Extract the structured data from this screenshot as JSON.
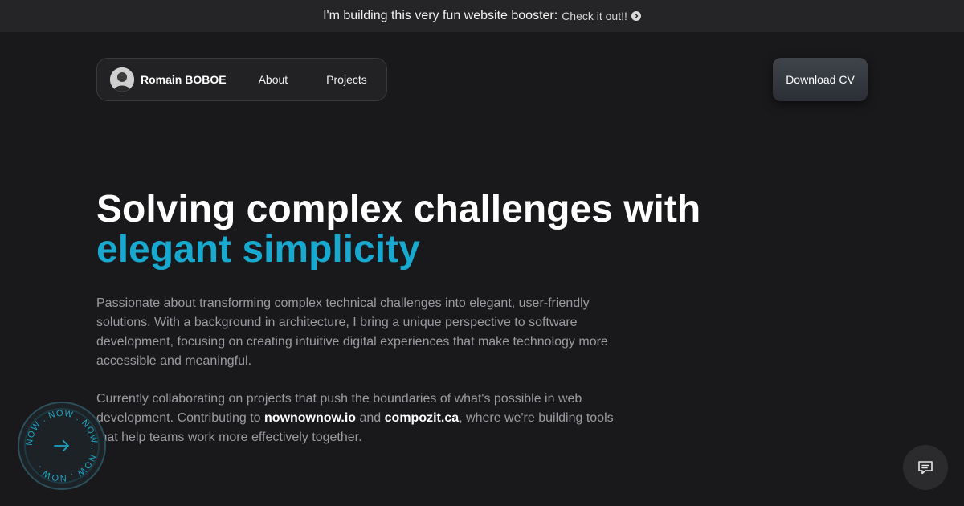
{
  "banner": {
    "text": "I'm building this very fun website booster:",
    "link_label": "Check it out!!",
    "link_icon": "chevron-right-circle-icon"
  },
  "nav": {
    "avatar_icon": "user-avatar",
    "brand": "Romain BOBOE",
    "items": [
      {
        "label": "About"
      },
      {
        "label": "Projects"
      }
    ]
  },
  "header": {
    "cv_button": "Download CV"
  },
  "hero": {
    "line1": "Solving complex challenges with",
    "line2": "elegant simplicity",
    "accent_color": "#17a9cf"
  },
  "intro": {
    "p1": "Passionate about transforming complex technical challenges into elegant, user-friendly solutions. With a background in architecture, I bring a unique perspective to software development, focusing on creating intuitive digital experiences that make technology more accessible and meaningful.",
    "p2_before": "Currently collaborating on projects that push the boundaries of what's possible in web development. Contributing to ",
    "p2_link1": "nownownow.io",
    "p2_mid": " and ",
    "p2_link2": "compozit.ca",
    "p2_after": ", where we're building tools that help teams work more effectively together."
  },
  "now_badge": {
    "ring_text": "NOW . NOW . NOW . NOW . NOW .",
    "icon": "arrow-right-icon"
  },
  "chat": {
    "icon": "chat-bubble-icon"
  }
}
